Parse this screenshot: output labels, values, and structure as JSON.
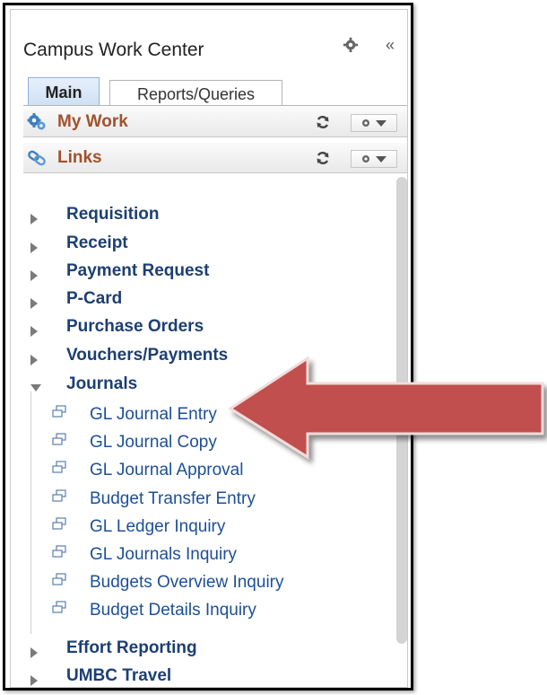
{
  "panel": {
    "title": "Campus Work Center",
    "tabs": [
      {
        "label": "Main",
        "active": true
      },
      {
        "label": "Reports/Queries",
        "active": false
      }
    ],
    "pagelets": [
      {
        "label": "My Work",
        "icon": "gears-icon"
      },
      {
        "label": "Links",
        "icon": "links-icon"
      }
    ]
  },
  "links": {
    "top_items": [
      {
        "label": "Requisition",
        "state": "collapsed"
      },
      {
        "label": "Receipt",
        "state": "collapsed"
      },
      {
        "label": "Payment Request",
        "state": "collapsed"
      },
      {
        "label": "P-Card",
        "state": "collapsed"
      },
      {
        "label": "Purchase Orders",
        "state": "collapsed"
      },
      {
        "label": "Vouchers/Payments",
        "state": "collapsed"
      },
      {
        "label": "Journals",
        "state": "expanded"
      },
      {
        "label": "Effort Reporting",
        "state": "collapsed"
      },
      {
        "label": "UMBC Travel",
        "state": "collapsed"
      }
    ],
    "journal_items": [
      "GL Journal Entry",
      "GL Journal Copy",
      "GL Journal Approval",
      "Budget Transfer Entry",
      "GL Ledger Inquiry",
      "GL Journals Inquiry",
      "Budgets Overview Inquiry",
      "Budget Details Inquiry"
    ]
  },
  "annotation": {
    "arrow_color": "#c0504d",
    "points_to": "GL Journal Entry"
  }
}
